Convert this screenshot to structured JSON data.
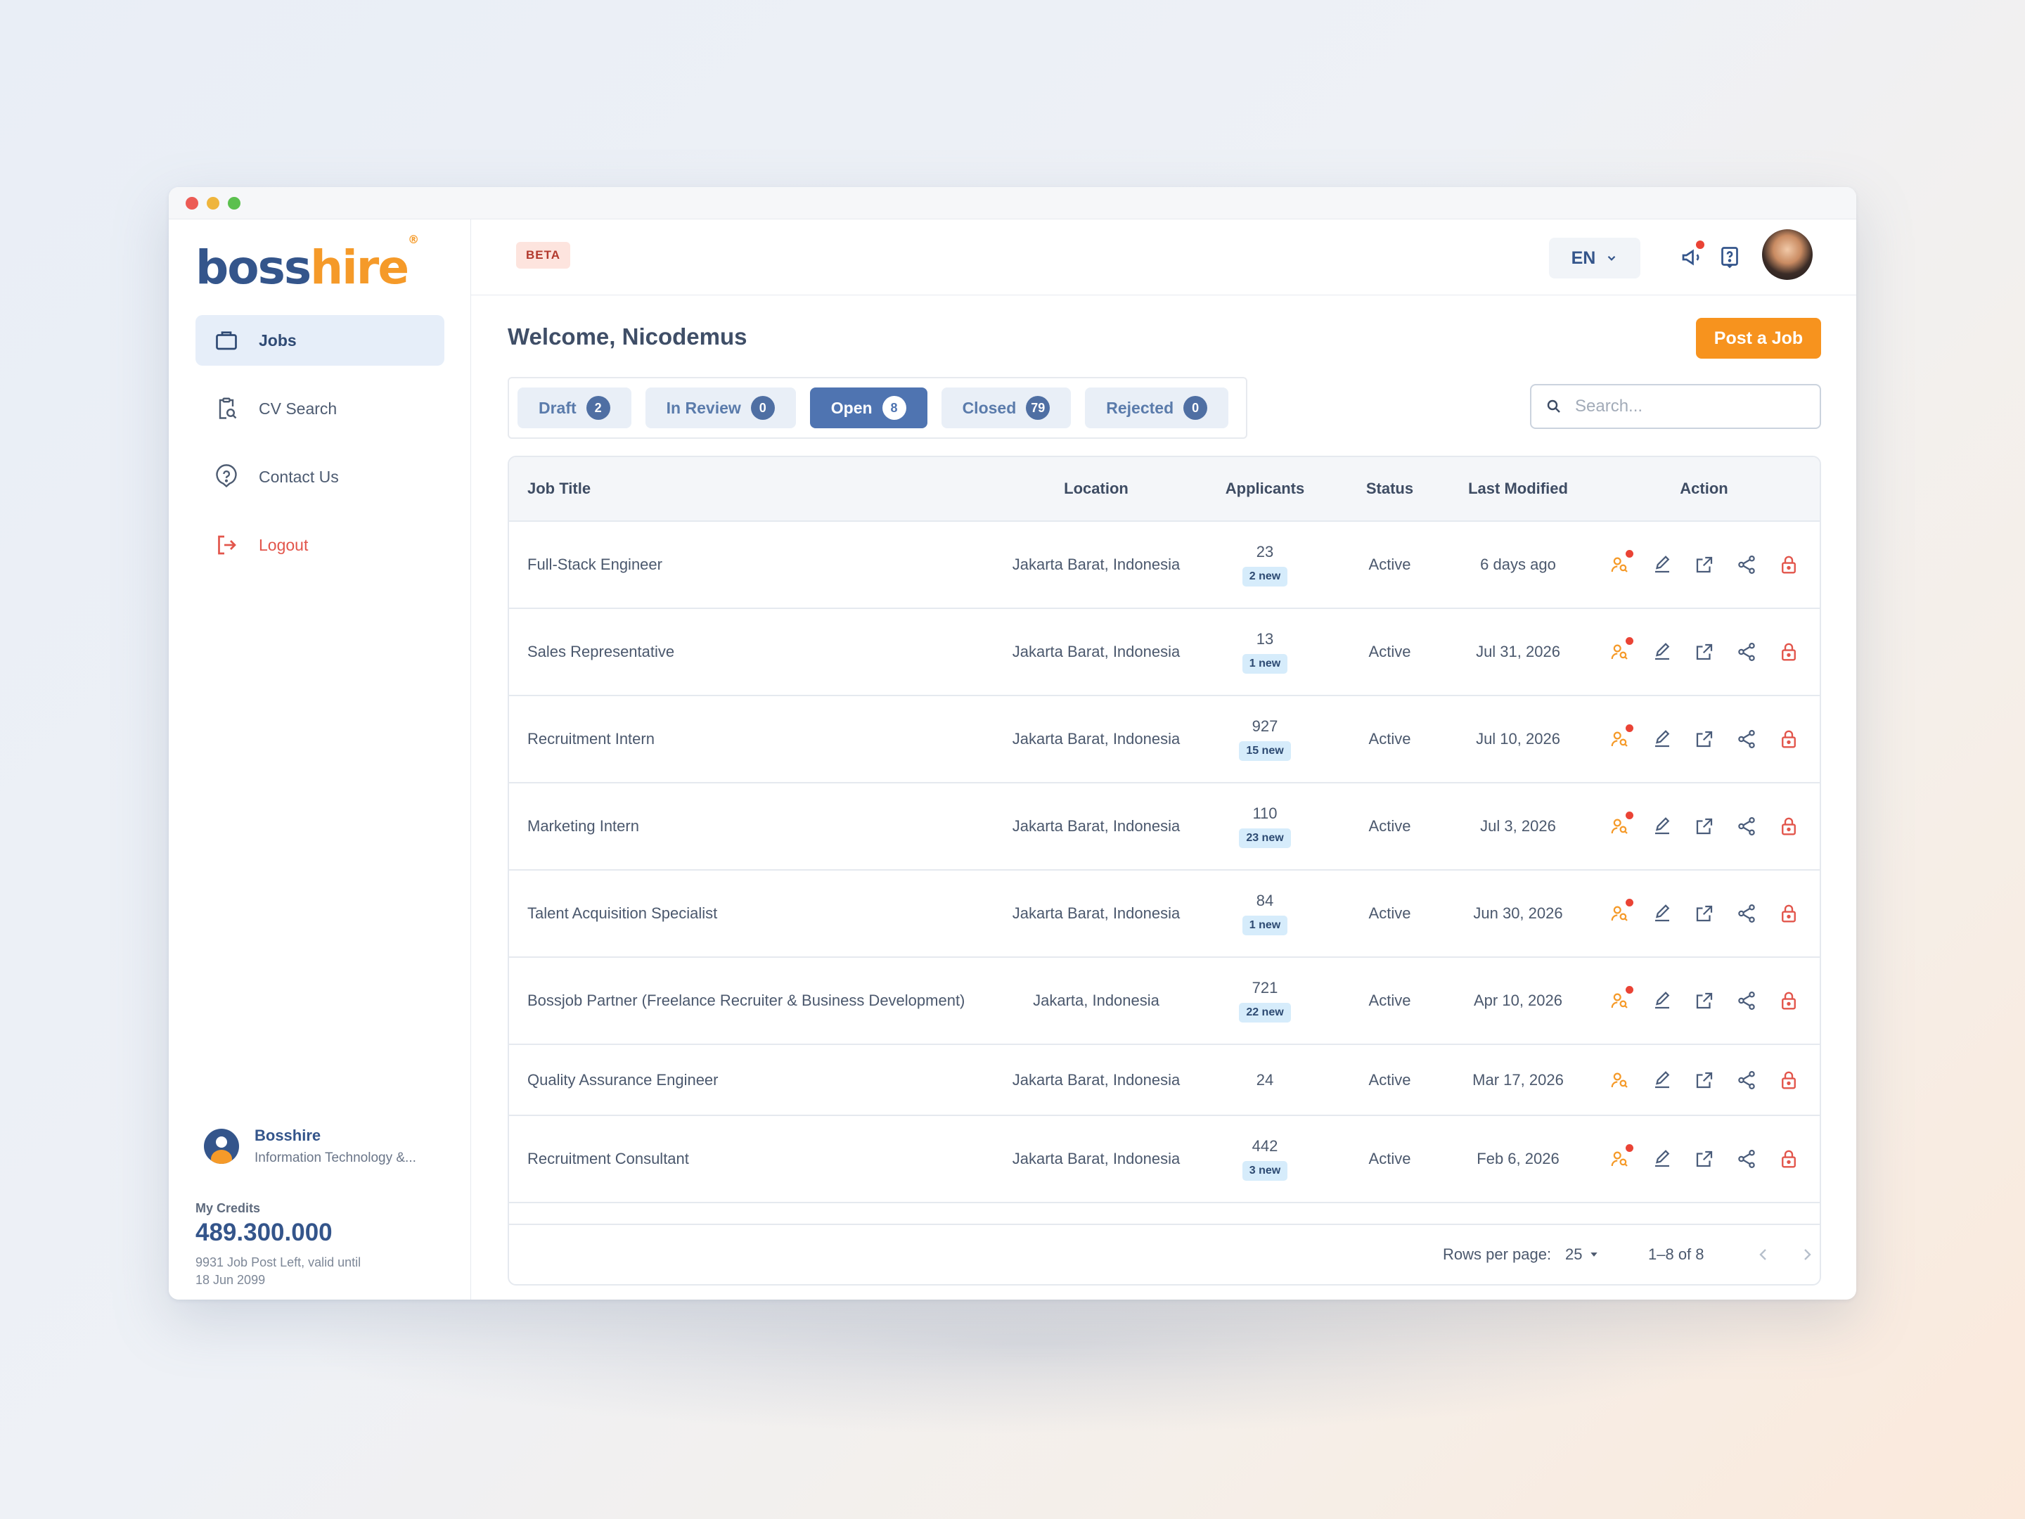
{
  "brand": {
    "logo_boss": "boss",
    "logo_hire": "hire",
    "registered": "®"
  },
  "sidebar": {
    "items": [
      {
        "label": "Jobs",
        "icon": "briefcase-icon",
        "active": true
      },
      {
        "label": "CV Search",
        "icon": "clipboard-search-icon"
      },
      {
        "label": "Contact Us",
        "icon": "help-circle-icon"
      },
      {
        "label": "Logout",
        "icon": "logout-icon"
      }
    ],
    "company": {
      "name": "Bosshire",
      "industry": "Information Technology &..."
    },
    "credits": {
      "label": "My Credits",
      "value": "489.300.000",
      "note": "9931 Job Post Left, valid until 18 Jun 2099"
    }
  },
  "topbar": {
    "beta_label": "BETA",
    "language": "EN",
    "icons": [
      "megaphone-icon",
      "help-icon",
      "user-avatar"
    ]
  },
  "main": {
    "welcome": "Welcome, Nicodemus",
    "post_job_label": "Post a Job",
    "tabs": [
      {
        "label": "Draft",
        "count": "2"
      },
      {
        "label": "In Review",
        "count": "0"
      },
      {
        "label": "Open",
        "count": "8",
        "active": true
      },
      {
        "label": "Closed",
        "count": "79"
      },
      {
        "label": "Rejected",
        "count": "0"
      }
    ],
    "search_placeholder": "Search..."
  },
  "table": {
    "headers": [
      "Job Title",
      "Location",
      "Applicants",
      "Status",
      "Last Modified",
      "Action"
    ],
    "rows": [
      {
        "title": "Full-Stack Engineer",
        "location": "Jakarta Barat, Indonesia",
        "applicants": "23",
        "new": "2 new",
        "status": "Active",
        "modified": "6 days ago"
      },
      {
        "title": "Sales Representative",
        "location": "Jakarta Barat, Indonesia",
        "applicants": "13",
        "new": "1 new",
        "status": "Active",
        "modified": "Jul 31, 2026"
      },
      {
        "title": "Recruitment Intern",
        "location": "Jakarta Barat, Indonesia",
        "applicants": "927",
        "new": "15 new",
        "status": "Active",
        "modified": "Jul 10, 2026"
      },
      {
        "title": "Marketing Intern",
        "location": "Jakarta Barat, Indonesia",
        "applicants": "110",
        "new": "23 new",
        "status": "Active",
        "modified": "Jul 3, 2026"
      },
      {
        "title": "Talent Acquisition Specialist",
        "location": "Jakarta Barat, Indonesia",
        "applicants": "84",
        "new": "1 new",
        "status": "Active",
        "modified": "Jun 30, 2026"
      },
      {
        "title": "Bossjob Partner (Freelance Recruiter & Business Development)",
        "location": "Jakarta, Indonesia",
        "applicants": "721",
        "new": "22 new",
        "status": "Active",
        "modified": "Apr 10, 2026"
      },
      {
        "title": "Quality Assurance Engineer",
        "location": "Jakarta Barat, Indonesia",
        "applicants": "24",
        "new": "",
        "status": "Active",
        "modified": "Mar 17, 2026"
      },
      {
        "title": "Recruitment Consultant",
        "location": "Jakarta Barat, Indonesia",
        "applicants": "442",
        "new": "3 new",
        "status": "Active",
        "modified": "Feb 6, 2026"
      }
    ],
    "action_icons": [
      "applicants-icon",
      "edit-icon",
      "open-external-icon",
      "share-icon",
      "lock-icon"
    ]
  },
  "pagination": {
    "rows_per_page_label": "Rows per page:",
    "rows_per_page": "25",
    "range": "1–8 of 8"
  },
  "colors": {
    "accent": "#f7931e",
    "brand_blue": "#34558b",
    "tab_active": "#4f74b1",
    "danger": "#e2554b"
  }
}
